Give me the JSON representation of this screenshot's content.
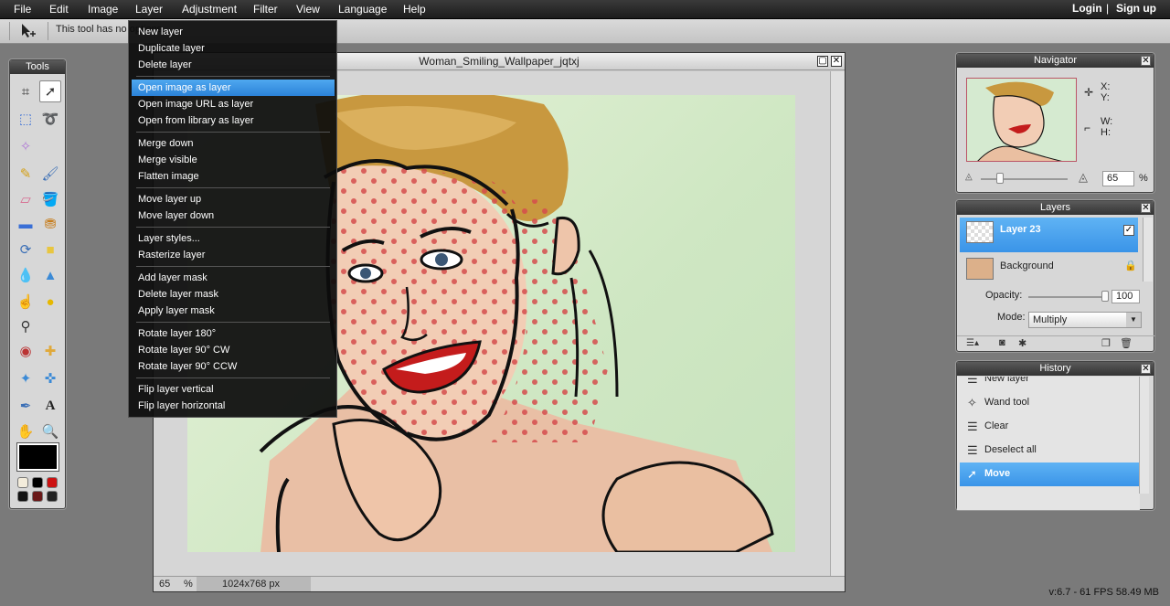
{
  "menu": {
    "items": [
      "File",
      "Edit",
      "Image",
      "Layer",
      "Adjustment",
      "Filter",
      "View",
      "Language",
      "Help"
    ],
    "login": "Login",
    "divider": "|",
    "signup": "Sign up"
  },
  "options_bar": {
    "hint": "This tool has no options"
  },
  "tools": {
    "title": "Tools",
    "items": [
      "crop-icon",
      "move-icon",
      "marquee-icon",
      "lasso-icon",
      "magic-wand-icon",
      "",
      "pencil-icon",
      "brush-icon",
      "eraser-icon",
      "bucket-icon",
      "gradient-icon",
      "clone-stamp-icon",
      "color-replace-icon",
      "shapes-icon",
      "blur-icon",
      "sharpen-icon",
      "smudge-icon",
      "sponge-icon",
      "dodge-burn-icon",
      "",
      "redeye-icon",
      "patch-icon",
      "bloat-icon",
      "pinch-icon",
      "color-picker-icon",
      "text-icon",
      "hand-icon",
      "zoom-icon"
    ],
    "primary_color": "#000000",
    "swatches": [
      "#f3ecdb",
      "#000000",
      "#cc1111",
      "#111111",
      "#6a1818",
      "#222222"
    ]
  },
  "canvas": {
    "title": "Woman_Smiling_Wallpaper_jqtxj",
    "zoom": "65",
    "zoom_unit": "%",
    "size": "1024x768 px"
  },
  "layer_menu": {
    "groups": [
      [
        "New layer",
        "Duplicate layer",
        "Delete layer"
      ],
      [
        "Open image as layer",
        "Open image URL as layer",
        "Open from library as layer"
      ],
      [
        "Merge down",
        "Merge visible",
        "Flatten image"
      ],
      [
        "Move layer up",
        "Move layer down"
      ],
      [
        "Layer styles...",
        "Rasterize layer"
      ],
      [
        "Add layer mask",
        "Delete layer mask",
        "Apply layer mask"
      ],
      [
        "Rotate layer 180°",
        "Rotate layer 90° CW",
        "Rotate layer 90° CCW"
      ],
      [
        "Flip layer vertical",
        "Flip layer horizontal"
      ]
    ],
    "highlighted": "Open image as layer"
  },
  "navigator": {
    "title": "Navigator",
    "x_label": "X:",
    "y_label": "Y:",
    "w_label": "W:",
    "h_label": "H:",
    "zoom": "65",
    "zoom_unit": "%",
    "zoom_slider_level": 0.2
  },
  "layers": {
    "title": "Layers",
    "items": [
      {
        "name": "Layer 23",
        "selected": true
      },
      {
        "name": "Background",
        "selected": false
      }
    ],
    "opacity_label": "Opacity:",
    "opacity": "100",
    "mode_label": "Mode:",
    "mode": "Multiply"
  },
  "history": {
    "title": "History",
    "items": [
      "New layer",
      "Wand tool",
      "Clear",
      "Deselect all",
      "Move"
    ],
    "selected": "Move"
  },
  "footer": {
    "version": "v:6.7 - 61 FPS 58.49 MB"
  }
}
